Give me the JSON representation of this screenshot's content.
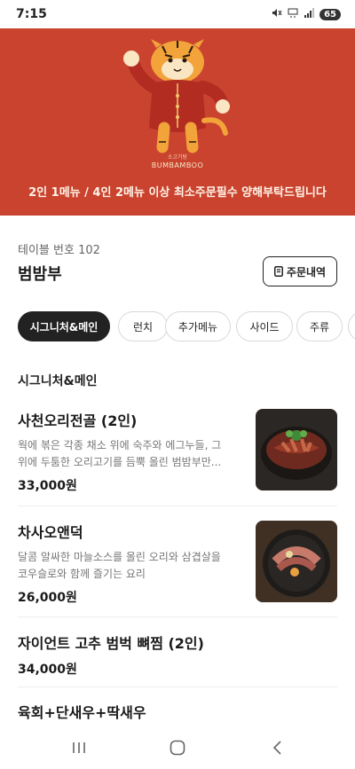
{
  "status_bar": {
    "time": "7:15",
    "battery": "65",
    "icons": [
      "mute-icon",
      "data-icon",
      "signal-icon",
      "battery-icon"
    ]
  },
  "banner": {
    "brand_tag": "소고기탕",
    "brand": "BUMBAMBOO",
    "notice": "2인 1메뉴 / 4인 2메뉴 이상 최소주문필수  양해부탁드립니다",
    "bg_color": "#c9432f"
  },
  "header": {
    "table_number": "테이블 번호 102",
    "store_name": "범밤부",
    "order_history_label": "주문내역"
  },
  "tabs": [
    {
      "label": "시그니처&메인",
      "active": true
    },
    {
      "label": "런치",
      "active": false
    },
    {
      "label": "추가메뉴",
      "active": false
    },
    {
      "label": "사이드",
      "active": false
    },
    {
      "label": "주류",
      "active": false
    }
  ],
  "section": {
    "title": "시그니처&메인"
  },
  "menu": [
    {
      "name": "사천오리전골 (2인)",
      "desc_line1": "웍에 볶은 각종 채소 위에 숙주와 에그누들, 그",
      "desc_line2": "위에 두툼한 오리고기를 듬뿍 올린 범밤부만...",
      "price": "33,000원"
    },
    {
      "name": "차사오앤덕",
      "desc_line1": "달콤 알싸한 마늘소스를 올린 오리와 삼겹살을",
      "desc_line2": "코우슬로와 함께 즐기는 요리",
      "price": "26,000원"
    },
    {
      "name": "자이언트 고추 범벅 뼈찜 (2인)",
      "price": "34,000원"
    },
    {
      "name": "육회+단새우+딱새우"
    }
  ],
  "nav": {
    "recent_icon": "recent-apps-icon",
    "home_icon": "home-icon",
    "back_icon": "back-icon"
  }
}
